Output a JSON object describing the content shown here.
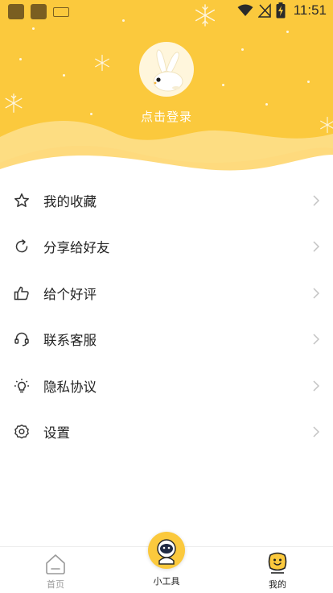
{
  "status_bar": {
    "time": "11:51",
    "icons": [
      "app-notification-icon",
      "app-notification-icon",
      "keyboard-icon",
      "wifi-icon",
      "no-signal-icon",
      "battery-charging-icon"
    ]
  },
  "profile": {
    "avatar_icon": "rabbit-avatar",
    "login_label": "点击登录"
  },
  "menu": [
    {
      "label": "我的收藏",
      "icon": "star-icon"
    },
    {
      "label": "分享给好友",
      "icon": "share-refresh-icon"
    },
    {
      "label": "给个好评",
      "icon": "thumbs-up-icon"
    },
    {
      "label": "联系客服",
      "icon": "headset-icon"
    },
    {
      "label": "隐私协议",
      "icon": "lightbulb-icon"
    },
    {
      "label": "设置",
      "icon": "gear-icon"
    }
  ],
  "bottom_nav": {
    "home_label": "首页",
    "tools_label": "小工具",
    "mine_label": "我的",
    "active": "我的"
  },
  "colors": {
    "accent": "#fbc93d",
    "nav_inactive": "#9a9a9a",
    "nav_active": "#222222",
    "chevron": "#c4c4c4"
  }
}
